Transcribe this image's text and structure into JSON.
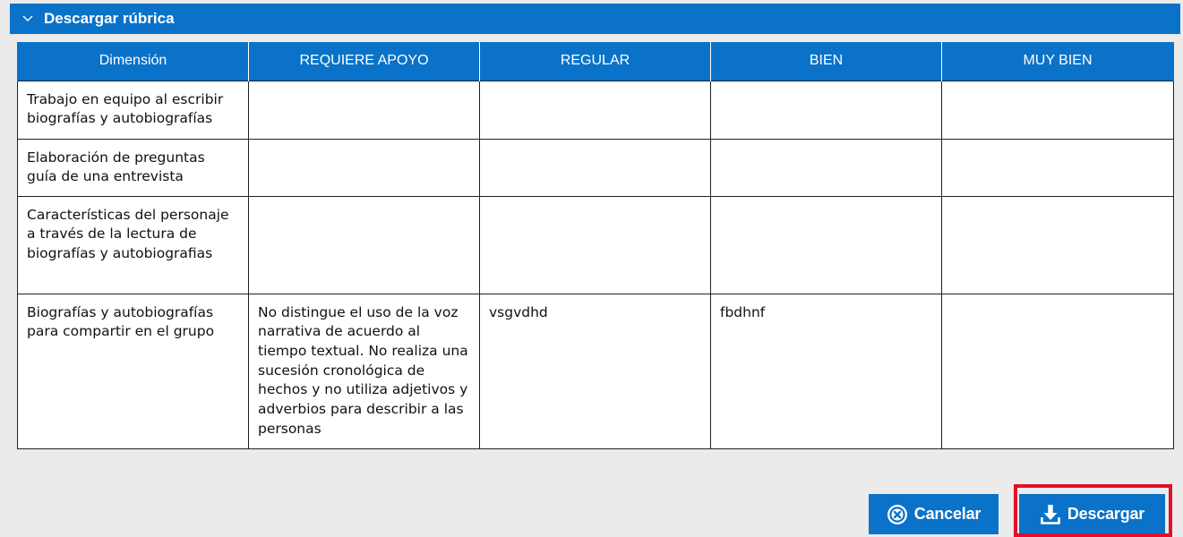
{
  "panel": {
    "title": "Descargar rúbrica",
    "toggle_icon": "chevron-down-icon"
  },
  "table": {
    "headers": [
      "Dimensión",
      "REQUIERE APOYO",
      "REGULAR",
      "BIEN",
      "MUY BIEN"
    ],
    "rows": [
      [
        "Trabajo en equipo al escribir biografías y autobiografías",
        "",
        "",
        "",
        ""
      ],
      [
        "Elaboración de preguntas guía de una entrevista",
        "",
        "",
        "",
        ""
      ],
      [
        "Características del personaje a través de la lectura de biografías y autobiografias",
        "",
        "",
        "",
        ""
      ],
      [
        "Biografías y autobiografías para compartir en el grupo",
        "No distingue el uso de la voz narrativa de acuerdo al tiempo textual. No realiza una sucesión cronológica de hechos y no utiliza adjetivos y adverbios para describir a las personas",
        "vsgvdhd",
        "fbdhnf",
        ""
      ]
    ]
  },
  "buttons": {
    "cancel": {
      "label": "Cancelar",
      "icon": "close-circle-icon"
    },
    "download": {
      "label": "Descargar",
      "icon": "download-icon"
    }
  },
  "colors": {
    "accent": "#0a72c8",
    "highlight": "#e0102a",
    "background": "#ebebeb"
  }
}
